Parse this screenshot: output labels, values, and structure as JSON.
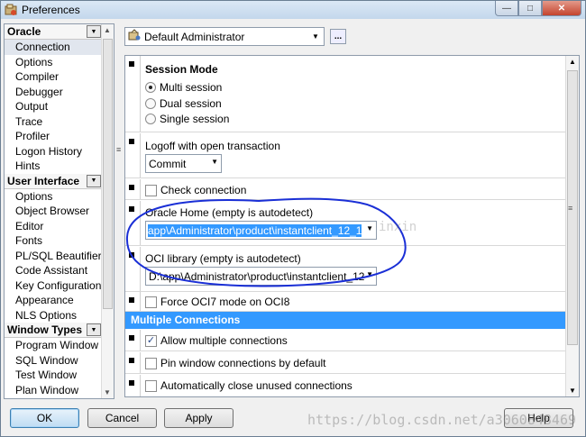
{
  "window": {
    "title": "Preferences"
  },
  "sidebar": {
    "groups": [
      {
        "label": "Oracle",
        "items": [
          "Connection",
          "Options",
          "Compiler",
          "Debugger",
          "Output",
          "Trace",
          "Profiler",
          "Logon History",
          "Hints"
        ],
        "selected": 0
      },
      {
        "label": "User Interface",
        "items": [
          "Options",
          "Object Browser",
          "Editor",
          "Fonts",
          "PL/SQL Beautifier",
          "Code Assistant",
          "Key Configuration",
          "Appearance",
          "NLS Options"
        ]
      },
      {
        "label": "Window Types",
        "items": [
          "Program Window",
          "SQL Window",
          "Test Window",
          "Plan Window"
        ]
      }
    ]
  },
  "profile": {
    "value": "Default Administrator",
    "more_label": "..."
  },
  "session": {
    "title": "Session Mode",
    "options": [
      "Multi session",
      "Dual session",
      "Single session"
    ],
    "selected": "Multi session"
  },
  "logoff": {
    "label": "Logoff with open transaction",
    "value": "Commit"
  },
  "check_connection": {
    "label": "Check connection",
    "checked": false
  },
  "oracle_home": {
    "label": "Oracle Home (empty is autodetect)",
    "value": "app\\Administrator\\product\\instantclient_12_1"
  },
  "oci_library": {
    "label": "OCI library (empty is autodetect)",
    "value": "D:\\app\\Administrator\\product\\instantclient_12"
  },
  "force_oci7": {
    "label": "Force OCI7 mode on OCI8",
    "checked": false
  },
  "multiple_connections": {
    "header": "Multiple Connections",
    "allow": {
      "label": "Allow multiple connections",
      "checked": true
    },
    "pin": {
      "label": "Pin window connections by default",
      "checked": false
    },
    "auto_close": {
      "label": "Automatically close unused connections",
      "checked": false
    }
  },
  "buttons": {
    "ok": "OK",
    "cancel": "Cancel",
    "apply": "Apply",
    "help": "Help"
  },
  "watermark": {
    "main": "https://blog.csdn.net/a3060848469",
    "overlay": "inxin"
  },
  "colors": {
    "selection": "#3399ff",
    "annotation": "#1a2fd6"
  }
}
